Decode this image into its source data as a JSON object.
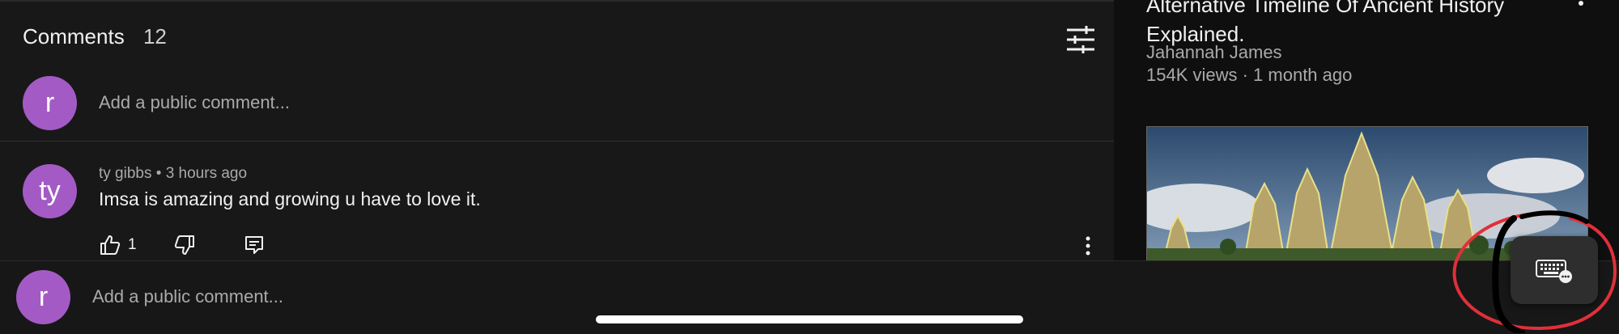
{
  "comments": {
    "title": "Comments",
    "count": "12",
    "add_placeholder": "Add a public comment...",
    "user_avatar_letter": "r"
  },
  "comment_item": {
    "avatar_letter": "ty",
    "author": "ty gibbs",
    "time": "3 hours ago",
    "text": "Imsa is amazing and growing u have to love it.",
    "likes": "1"
  },
  "bottom_bar": {
    "avatar_letter": "r",
    "placeholder": "Add a public comment..."
  },
  "related_video": {
    "title": "Alternative Timeline Of Ancient History Explained.",
    "channel": "Jahannah James",
    "stats": "154K views · 1 month ago"
  },
  "icons": {
    "sort": "sort-filter-icon",
    "like": "thumbs-up-icon",
    "dislike": "thumbs-down-icon",
    "reply": "reply-icon",
    "more": "more-vertical-icon",
    "keyboard": "keyboard-icon"
  },
  "colors": {
    "avatar": "#a35ac5",
    "annotation": "#e0303a",
    "background": "#181818"
  }
}
